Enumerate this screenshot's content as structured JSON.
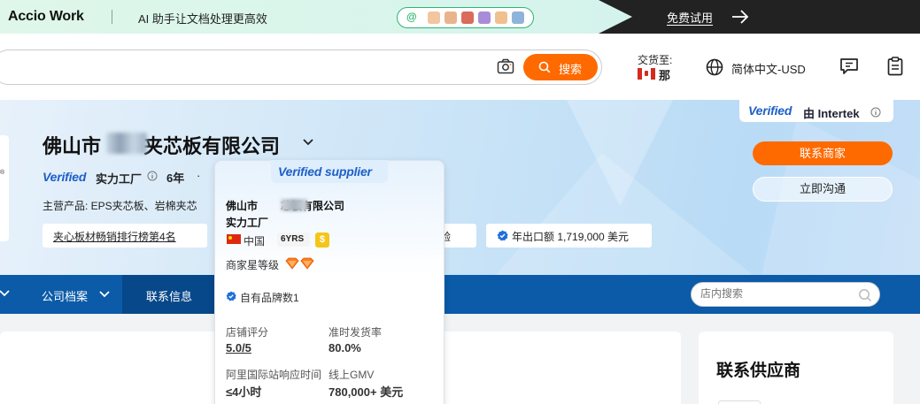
{
  "banner": {
    "logo": "Accio Work",
    "slogan": "AI 助手让文档处理更高效",
    "pill_at": "@",
    "trial_label": "免费试用"
  },
  "header": {
    "search_button": "搜索",
    "ship_to_label": "交货至:",
    "ship_to_value": "那",
    "language": "简体中文-USD"
  },
  "hero": {
    "company_name": "佛山市",
    "company_name_suffix": "夹芯板有限公司",
    "verified_label": "Verified",
    "power_factory": "实力工厂",
    "years": "6年",
    "dot": "·",
    "main_products": "主营产品: EPS夹芯板、岩棉夹芯",
    "left_card_mark": "®",
    "tags": {
      "ranking": "夹心板材畅销排行榜第4名",
      "inspection": "检验",
      "export": "年出口额 1,719,000 美元"
    },
    "intertek": {
      "verified": "Verified",
      "by": "由 Intertek"
    },
    "contact_button": "联系商家",
    "chat_button": "立即沟通"
  },
  "nav": {
    "profile": "公司档案",
    "contact_info": "联系信息",
    "shop_search_placeholder": "店内搜索"
  },
  "lower": {
    "contact_supplier_title": "联系供应商"
  },
  "popover": {
    "badge": "Verified supplier",
    "name_prefix": "佛山市",
    "name_suffix": "芯板有限公司",
    "power_factory": "实力工厂",
    "country": "中国",
    "years_badge": "6YRS",
    "coin": "$",
    "star_label": "商家星等级",
    "star_count": 2,
    "brand_count": "自有品牌数1",
    "stats": [
      {
        "label": "店铺评分",
        "value": "5.0/5"
      },
      {
        "label": "准时发货率",
        "value": "80.0%"
      },
      {
        "label": "阿里国际站响应时间",
        "value": "≤4小时"
      },
      {
        "label": "线上GMV",
        "value": "780,000+ 美元"
      }
    ]
  },
  "colors": {
    "brand_orange": "#ff6a00",
    "nav_blue": "#0b5ba8",
    "verified_blue": "#1e5fc8",
    "green": "#2bb673"
  }
}
